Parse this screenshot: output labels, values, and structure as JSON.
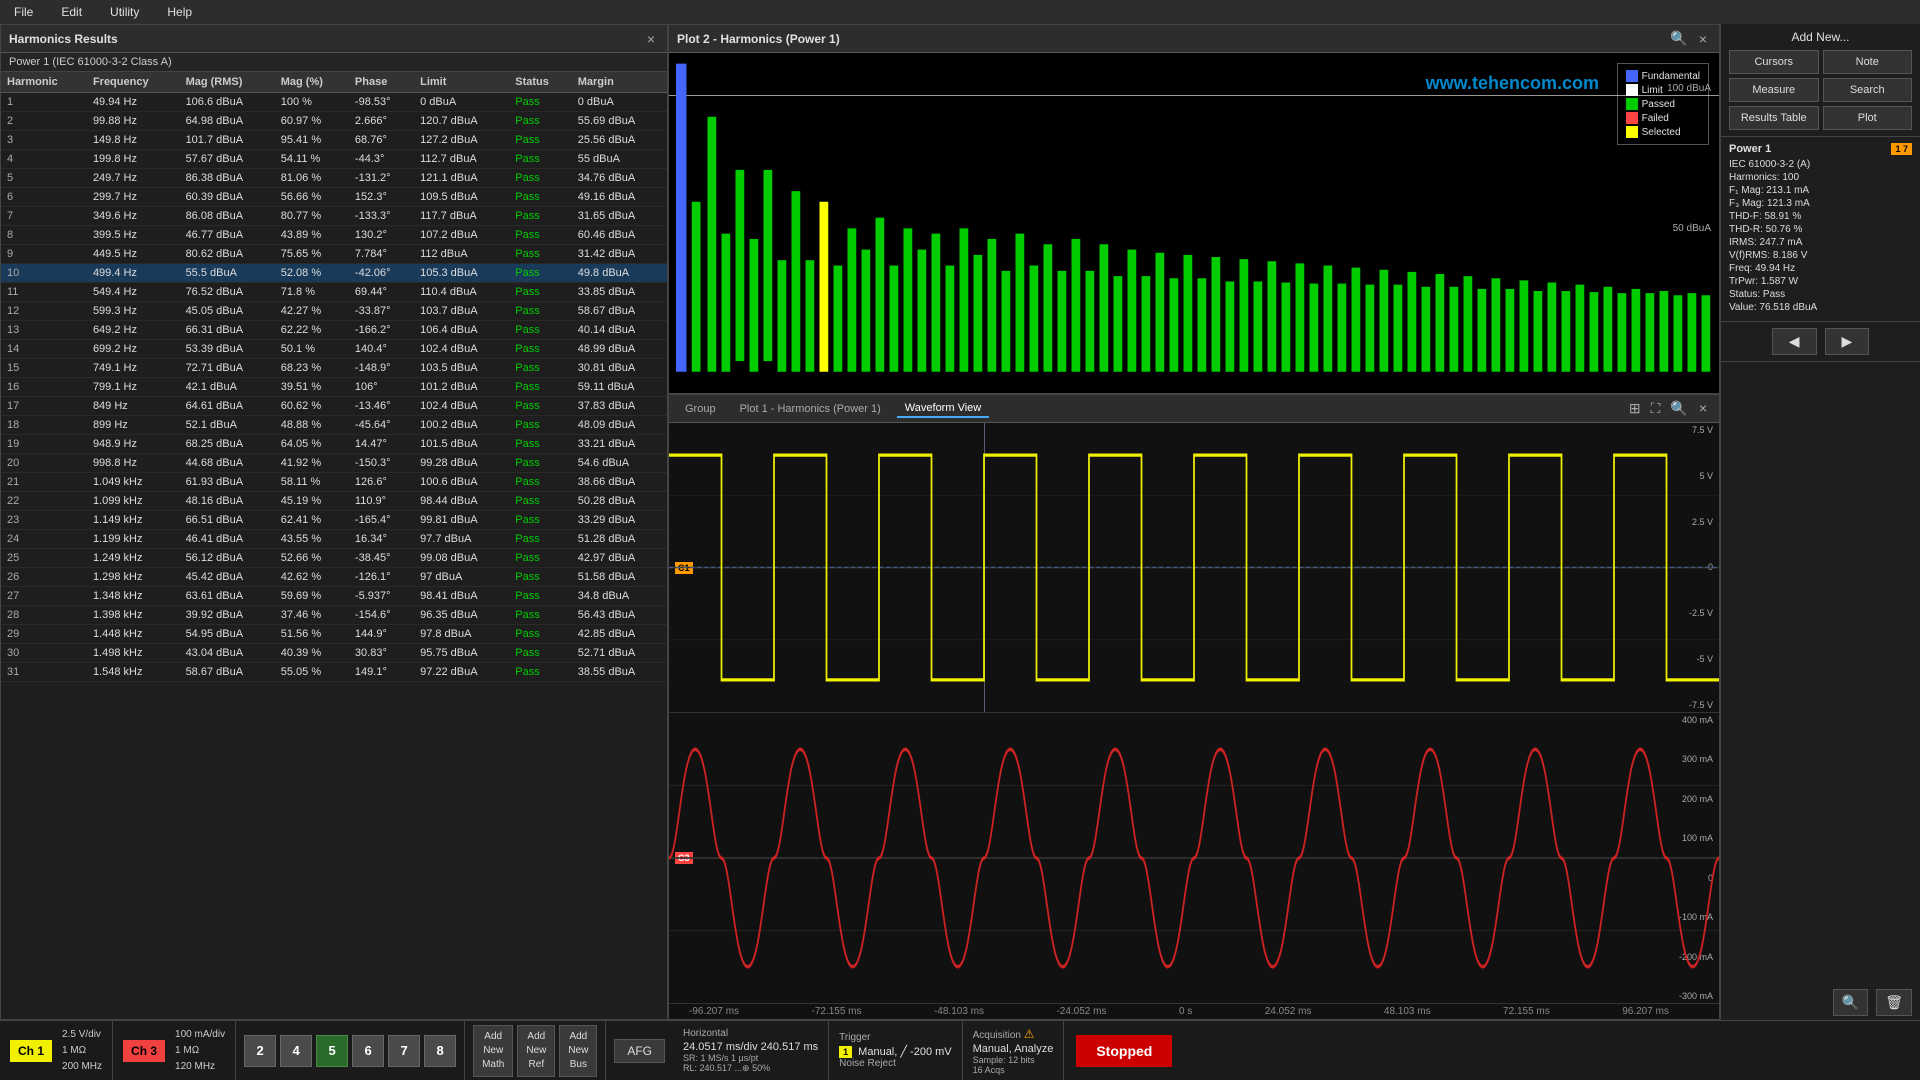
{
  "menubar": {
    "items": [
      "File",
      "Edit",
      "Utility",
      "Help"
    ]
  },
  "harmonics_panel": {
    "title": "Harmonics Results",
    "close_label": "×",
    "subtitle": "Power 1 (IEC 61000-3-2  Class A)",
    "columns": [
      "Harmonic",
      "Frequency",
      "Mag (RMS)",
      "Mag (%)",
      "Phase",
      "Limit",
      "Status",
      "Margin"
    ],
    "rows": [
      [
        "",
        "49.94 Hz",
        "106.6 dBuA",
        "100 %",
        "-98.53°",
        "0 dBuA",
        "Pass",
        "0 dBuA"
      ],
      [
        "1",
        "49.94 Hz",
        "106.6 dBuA",
        "100 %",
        "-98.53°",
        "0 dBuA",
        "Pass",
        "0 dBuA"
      ],
      [
        "2",
        "99.88 Hz",
        "64.98 dBuA",
        "60.97 %",
        "2.666°",
        "120.7 dBuA",
        "Pass",
        "55.69 dBuA"
      ],
      [
        "3",
        "149.8 Hz",
        "101.7 dBuA",
        "95.41 %",
        "68.76°",
        "127.2 dBuA",
        "Pass",
        "25.56 dBuA"
      ],
      [
        "4",
        "199.8 Hz",
        "57.67 dBuA",
        "54.11 %",
        "-44.3°",
        "112.7 dBuA",
        "Pass",
        "55 dBuA"
      ],
      [
        "5",
        "249.7 Hz",
        "86.38 dBuA",
        "81.06 %",
        "-131.2°",
        "121.1 dBuA",
        "Pass",
        "34.76 dBuA"
      ],
      [
        "6",
        "299.7 Hz",
        "60.39 dBuA",
        "56.66 %",
        "152.3°",
        "109.5 dBuA",
        "Pass",
        "49.16 dBuA"
      ],
      [
        "7",
        "349.6 Hz",
        "86.08 dBuA",
        "80.77 %",
        "-133.3°",
        "117.7 dBuA",
        "Pass",
        "31.65 dBuA"
      ],
      [
        "8",
        "399.5 Hz",
        "46.77 dBuA",
        "43.89 %",
        "130.2°",
        "107.2 dBuA",
        "Pass",
        "60.46 dBuA"
      ],
      [
        "9",
        "449.5 Hz",
        "80.62 dBuA",
        "75.65 %",
        "7.784°",
        "112 dBuA",
        "Pass",
        "31.42 dBuA"
      ],
      [
        "10",
        "499.4 Hz",
        "55.5 dBuA",
        "52.08 %",
        "-42.06°",
        "105.3 dBuA",
        "Pass",
        "49.8 dBuA"
      ],
      [
        "11",
        "549.4 Hz",
        "76.52 dBuA",
        "71.8 %",
        "69.44°",
        "110.4 dBuA",
        "Pass",
        "33.85 dBuA"
      ],
      [
        "12",
        "599.3 Hz",
        "45.05 dBuA",
        "42.27 %",
        "-33.87°",
        "103.7 dBuA",
        "Pass",
        "58.67 dBuA"
      ],
      [
        "13",
        "649.2 Hz",
        "66.31 dBuA",
        "62.22 %",
        "-166.2°",
        "106.4 dBuA",
        "Pass",
        "40.14 dBuA"
      ],
      [
        "14",
        "699.2 Hz",
        "53.39 dBuA",
        "50.1 %",
        "140.4°",
        "102.4 dBuA",
        "Pass",
        "48.99 dBuA"
      ],
      [
        "15",
        "749.1 Hz",
        "72.71 dBuA",
        "68.23 %",
        "-148.9°",
        "103.5 dBuA",
        "Pass",
        "30.81 dBuA"
      ],
      [
        "16",
        "799.1 Hz",
        "42.1 dBuA",
        "39.51 %",
        "106°",
        "101.2 dBuA",
        "Pass",
        "59.11 dBuA"
      ],
      [
        "17",
        "849 Hz",
        "64.61 dBuA",
        "60.62 %",
        "-13.46°",
        "102.4 dBuA",
        "Pass",
        "37.83 dBuA"
      ],
      [
        "18",
        "899 Hz",
        "52.1 dBuA",
        "48.88 %",
        "-45.64°",
        "100.2 dBuA",
        "Pass",
        "48.09 dBuA"
      ],
      [
        "19",
        "948.9 Hz",
        "68.25 dBuA",
        "64.05 %",
        "14.47°",
        "101.5 dBuA",
        "Pass",
        "33.21 dBuA"
      ],
      [
        "20",
        "998.8 Hz",
        "44.68 dBuA",
        "41.92 %",
        "-150.3°",
        "99.28 dBuA",
        "Pass",
        "54.6 dBuA"
      ],
      [
        "21",
        "1.049 kHz",
        "61.93 dBuA",
        "58.11 %",
        "126.6°",
        "100.6 dBuA",
        "Pass",
        "38.66 dBuA"
      ],
      [
        "22",
        "1.099 kHz",
        "48.16 dBuA",
        "45.19 %",
        "110.9°",
        "98.44 dBuA",
        "Pass",
        "50.28 dBuA"
      ],
      [
        "23",
        "1.149 kHz",
        "66.51 dBuA",
        "62.41 %",
        "-165.4°",
        "99.81 dBuA",
        "Pass",
        "33.29 dBuA"
      ],
      [
        "24",
        "1.199 kHz",
        "46.41 dBuA",
        "43.55 %",
        "16.34°",
        "97.7 dBuA",
        "Pass",
        "51.28 dBuA"
      ],
      [
        "25",
        "1.249 kHz",
        "56.12 dBuA",
        "52.66 %",
        "-38.45°",
        "99.08 dBuA",
        "Pass",
        "42.97 dBuA"
      ],
      [
        "26",
        "1.298 kHz",
        "45.42 dBuA",
        "42.62 %",
        "-126.1°",
        "97 dBuA",
        "Pass",
        "51.58 dBuA"
      ],
      [
        "27",
        "1.348 kHz",
        "63.61 dBuA",
        "59.69 %",
        "-5.937°",
        "98.41 dBuA",
        "Pass",
        "34.8 dBuA"
      ],
      [
        "28",
        "1.398 kHz",
        "39.92 dBuA",
        "37.46 %",
        "-154.6°",
        "96.35 dBuA",
        "Pass",
        "56.43 dBuA"
      ],
      [
        "29",
        "1.448 kHz",
        "54.95 dBuA",
        "51.56 %",
        "144.9°",
        "97.8 dBuA",
        "Pass",
        "42.85 dBuA"
      ],
      [
        "30",
        "1.498 kHz",
        "43.04 dBuA",
        "40.39 %",
        "30.83°",
        "95.75 dBuA",
        "Pass",
        "52.71 dBuA"
      ],
      [
        "31",
        "1.548 kHz",
        "58.67 dBuA",
        "55.05 %",
        "149.1°",
        "97.22 dBuA",
        "Pass",
        "38.55 dBuA"
      ]
    ],
    "selected_row": 10
  },
  "plot2": {
    "title": "Plot 2 - Harmonics (Power 1)",
    "close_label": "×",
    "watermark": "www.tehencom.com",
    "legend": {
      "items": [
        {
          "label": "Fundamental",
          "color": "#4466ff"
        },
        {
          "label": "Limit",
          "color": "#ffffff"
        },
        {
          "label": "Passed",
          "color": "#00cc00"
        },
        {
          "label": "Failed",
          "color": "#ff4444"
        },
        {
          "label": "Selected",
          "color": "#ffff00"
        }
      ]
    },
    "y_labels": [
      "100 dBuA",
      "50 dBuA"
    ]
  },
  "waveform": {
    "tabs": [
      "Group",
      "Plot 1 - Harmonics (Power 1)",
      "Waveform View"
    ],
    "active_tab": "Waveform View",
    "close_label": "×",
    "ch1_label": "C1",
    "ch3_label": "C3",
    "ch1_y_scale": [
      "7.5 V",
      "5 V",
      "2.5 V",
      "0",
      "-2.5 V",
      "-5 V",
      "-7.5 V"
    ],
    "ch3_y_scale": [
      "400 mA",
      "300 mA",
      "200 mA",
      "100 mA",
      "0",
      "-100 mA",
      "-200 mA",
      "-300 mA"
    ],
    "time_labels": [
      "-96.207 ms",
      "-72.155 ms",
      "-48.103 ms",
      "-24.052 ms",
      "0 s",
      "24.052 ms",
      "48.103 ms",
      "72.155 ms",
      "96.207 ms"
    ]
  },
  "right_panel": {
    "add_new_label": "Add New...",
    "buttons": {
      "cursors": "Cursors",
      "note": "Note",
      "measure": "Measure",
      "search": "Search",
      "results_table": "Results Table",
      "plot": "Plot"
    },
    "power1": {
      "title": "Power 1",
      "badge": "1 7",
      "spec": "IEC 61000-3-2 (A)",
      "harmonics": "Harmonics: 100",
      "f1_mag": "F₁ Mag:    213.1 mA",
      "f3_mag": "F₃ Mag:    121.3 mA",
      "thd_f": "THD-F:     58.91 %",
      "thd_r": "THD-R:     50.76 %",
      "irms": "IRMS:      247.7 mA",
      "vfrms": "V(f)RMS:   8.186 V",
      "freq": "Freq:      49.94 Hz",
      "trpwr": "TrPwr:     1.587 W",
      "status": "Status:    Pass",
      "value": "Value: 76.518 dBuA"
    },
    "nav": {
      "prev": "◀",
      "next": "▶"
    }
  },
  "bottom_bar": {
    "ch1": {
      "label": "Ch 1",
      "details": [
        "2.5 V/div",
        "1 MΩ",
        "200 MHz"
      ]
    },
    "ch3": {
      "label": "Ch 3",
      "details": [
        "100 mA/div",
        "1 MΩ",
        "120 MHz"
      ]
    },
    "num_buttons": [
      "2",
      "4",
      "5",
      "6",
      "7",
      "8"
    ],
    "add_buttons": [
      {
        "label": "Add\nNew\nMath"
      },
      {
        "label": "Add\nNew\nRef"
      },
      {
        "label": "Add\nNew\nBus"
      }
    ],
    "afg": "AFG",
    "horizontal": {
      "title": "Horizontal",
      "value1": "24.0517 ms/div  240.517 ms",
      "value2": "SR: 1 MS/s     1 μs/pt",
      "value3": "RL: 240.517 ...⊕ 50%"
    },
    "trigger": {
      "title": "Trigger",
      "ch_badge": "1",
      "details": [
        "Manual, ╱  -200 mV",
        "Noise Reject"
      ]
    },
    "acquisition": {
      "title": "Acquisition",
      "warn": "⚠",
      "details": [
        "Manual,    Analyze",
        "Sample: 12 bits",
        "16 Acqs"
      ]
    },
    "stopped": "Stopped"
  }
}
